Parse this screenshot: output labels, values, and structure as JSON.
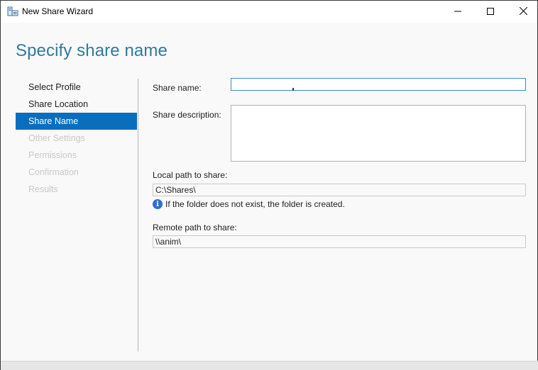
{
  "window": {
    "title": "New Share Wizard",
    "app_icon": "server-manager-icon"
  },
  "controls": {
    "minimize_icon": "minimize-icon",
    "maximize_icon": "maximize-icon",
    "close_icon": "close-icon"
  },
  "page": {
    "heading": "Specify share name"
  },
  "nav": {
    "items": [
      {
        "label": "Select Profile",
        "state": "normal"
      },
      {
        "label": "Share Location",
        "state": "normal"
      },
      {
        "label": "Share Name",
        "state": "selected"
      },
      {
        "label": "Other Settings",
        "state": "disabled"
      },
      {
        "label": "Permissions",
        "state": "disabled"
      },
      {
        "label": "Confirmation",
        "state": "disabled"
      },
      {
        "label": "Results",
        "state": "disabled"
      }
    ]
  },
  "form": {
    "share_name_label": "Share name:",
    "share_name_value": "",
    "share_description_label": "Share description:",
    "share_description_value": "",
    "local_path_label": "Local path to share:",
    "local_path_value": "C:\\Shares\\",
    "info_text": "If the folder does not exist, the folder is created.",
    "remote_path_label": "Remote path to share:",
    "remote_path_value": "\\\\anim\\"
  },
  "colors": {
    "heading": "#2f7a9e",
    "selected_nav": "#0a6ebd",
    "disabled_nav": "#c8c8c8",
    "info_icon": "#2d72c9"
  }
}
